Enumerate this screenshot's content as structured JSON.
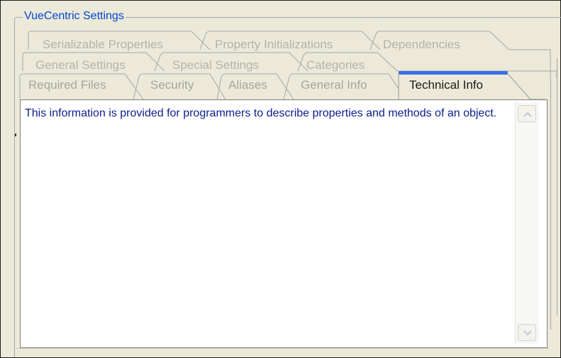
{
  "group": {
    "title": "VueCentric Settings"
  },
  "tabs": {
    "row1": [
      {
        "label": "Serializable Properties"
      },
      {
        "label": "Property Initializations"
      },
      {
        "label": "Dependencies"
      }
    ],
    "row2": [
      {
        "label": "General Settings"
      },
      {
        "label": "Special Settings"
      },
      {
        "label": "Categories"
      }
    ],
    "row3": [
      {
        "label": "Required Files"
      },
      {
        "label": "Security"
      },
      {
        "label": "Aliases"
      },
      {
        "label": "General Info"
      },
      {
        "label": "Technical Info",
        "active": true
      }
    ]
  },
  "content": {
    "text": "This information is provided for programmers to describe properties and methods of an object."
  },
  "colors": {
    "accent": "#3a6ee8",
    "text_blue": "#0b1e8c",
    "group_title": "#0046d5"
  },
  "icons": {
    "scroll_up": "chevron-up-icon",
    "scroll_down": "chevron-down-icon"
  }
}
